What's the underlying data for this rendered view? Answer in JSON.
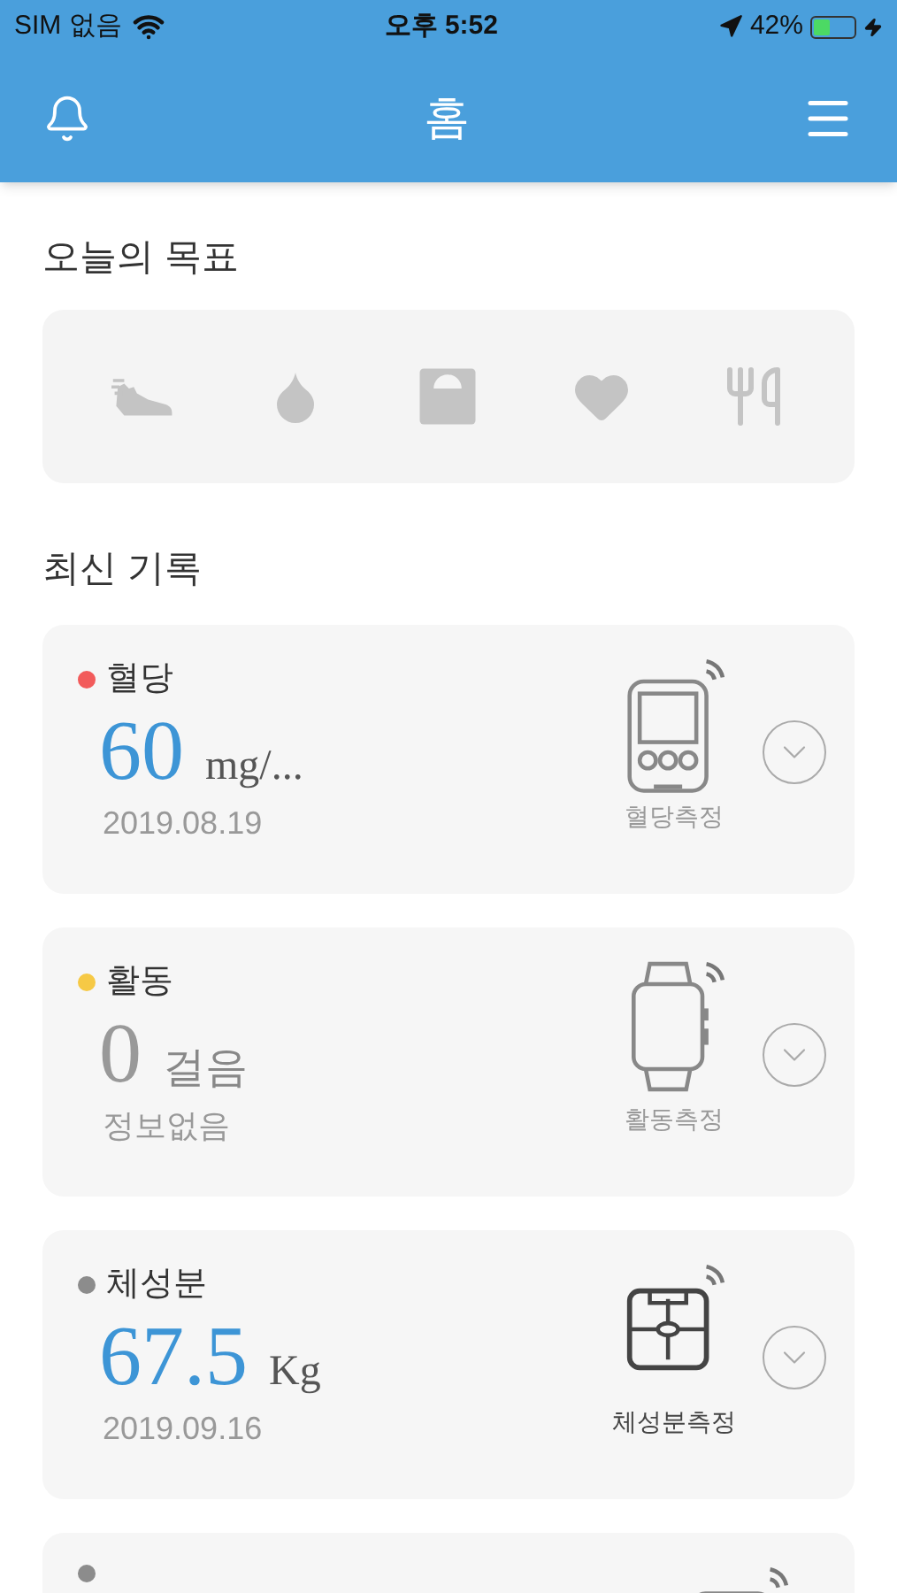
{
  "status_bar": {
    "carrier": "SIM 없음",
    "time": "오후 5:52",
    "battery_text": "42%",
    "battery": {
      "level": 0.42
    },
    "charging": true
  },
  "header": {
    "title": "홈"
  },
  "goals": {
    "title": "오늘의 목표",
    "items": [
      {
        "kind": "shoe"
      },
      {
        "kind": "drop"
      },
      {
        "kind": "scale"
      },
      {
        "kind": "heart"
      },
      {
        "kind": "meal"
      }
    ]
  },
  "records": {
    "title": "최신 기록",
    "items": [
      {
        "name": "혈당",
        "color": "#f25b5b",
        "value": "60",
        "unit": "mg/...",
        "date": "2019.08.19",
        "has_data": true,
        "kind": "meter",
        "device_label": "혈당측정",
        "device_connected": false
      },
      {
        "name": "활동",
        "color": "#f6c945",
        "value": "0",
        "unit": "걸음",
        "date": "정보없음",
        "has_data": false,
        "kind": "watch",
        "device_label": "활동측정",
        "device_connected": false
      },
      {
        "name": "체성분",
        "color": "#8c8c8c",
        "value": "67.5",
        "unit": "Kg",
        "date": "2019.09.16",
        "has_data": true,
        "kind": "scale",
        "device_label": "체성분측정",
        "device_connected": true
      },
      {
        "color": "#8c8c8c",
        "kind": "bp"
      }
    ]
  }
}
